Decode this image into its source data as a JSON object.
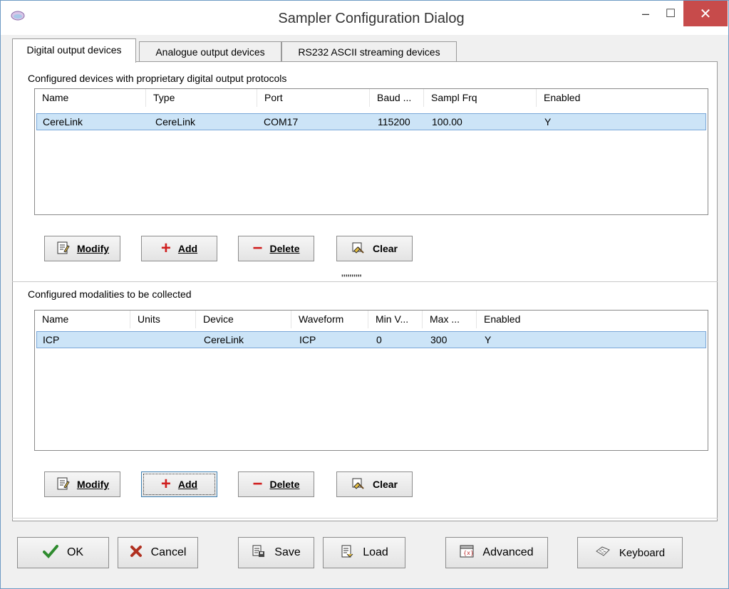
{
  "window": {
    "title": "Sampler Configuration Dialog",
    "minimize_glyph": "–",
    "maximize_glyph": "☐",
    "close_glyph": "✕"
  },
  "tabs": [
    {
      "label": "Digital output devices",
      "active": true
    },
    {
      "label": "Analogue output devices",
      "active": false
    },
    {
      "label": "RS232 ASCII streaming devices",
      "active": false
    }
  ],
  "devices": {
    "label": "Configured devices with proprietary digital output protocols",
    "columns": [
      "Name",
      "Type",
      "Port",
      "Baud ...",
      "Sampl Frq",
      "Enabled"
    ],
    "rows": [
      [
        "CereLink",
        "CereLink",
        "COM17",
        "115200",
        "100.00",
        "Y"
      ]
    ],
    "buttons": {
      "modify": "Modify",
      "add": "Add",
      "delete": "Delete",
      "clear": "Clear"
    }
  },
  "splitter_grip": "''''''''''",
  "modalities": {
    "label": "Configured modalities to be collected",
    "columns": [
      "Name",
      "Units",
      "Device",
      "Waveform",
      "Min V...",
      "Max ...",
      "Enabled"
    ],
    "rows": [
      [
        "ICP",
        "",
        "CereLink",
        "ICP",
        "0",
        "300",
        "Y"
      ]
    ],
    "buttons": {
      "modify": "Modify",
      "add": "Add",
      "delete": "Delete",
      "clear": "Clear"
    }
  },
  "footer": {
    "ok": "OK",
    "cancel": "Cancel",
    "save": "Save",
    "load": "Load",
    "advanced": "Advanced",
    "keyboard": "Keyboard"
  },
  "colors": {
    "selection": "#cce4f7",
    "close_button": "#c74b4b",
    "ok_check": "#2e8b2e",
    "cancel_x": "#b03020",
    "add_plus": "#d02020",
    "delete_minus": "#d02020"
  }
}
